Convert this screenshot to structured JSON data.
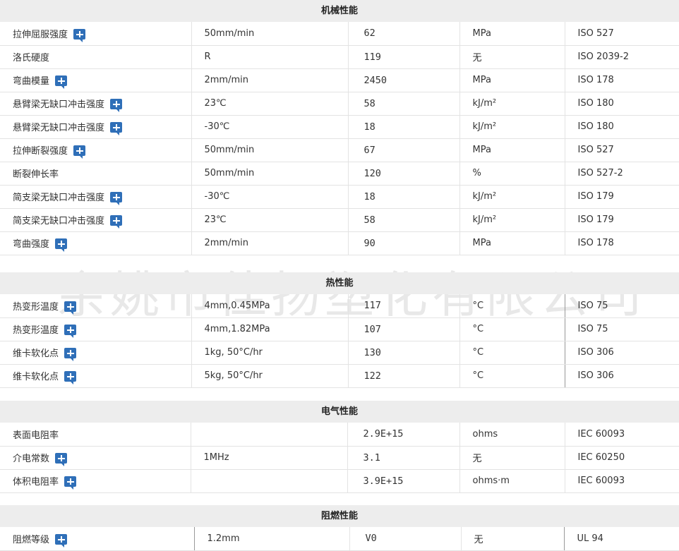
{
  "sections": [
    {
      "title": "机械性能",
      "rows": [
        {
          "property": "拉伸屈服强度",
          "plus": true,
          "condition": "50mm/min",
          "value": "62",
          "unit": "MPa",
          "standard": "ISO 527"
        },
        {
          "property": "洛氏硬度",
          "plus": false,
          "condition": "R",
          "value": "119",
          "unit": "无",
          "standard": "ISO 2039-2"
        },
        {
          "property": "弯曲模量",
          "plus": true,
          "condition": "2mm/min",
          "value": "2450",
          "unit": "MPa",
          "standard": "ISO 178"
        },
        {
          "property": "悬臂梁无缺口冲击强度",
          "plus": true,
          "condition": "23℃",
          "value": "58",
          "unit": "kJ/m²",
          "standard": "ISO 180"
        },
        {
          "property": "悬臂梁无缺口冲击强度",
          "plus": true,
          "condition": "-30℃",
          "value": "18",
          "unit": "kJ/m²",
          "standard": "ISO 180"
        },
        {
          "property": "拉伸断裂强度",
          "plus": true,
          "condition": "50mm/min",
          "value": "67",
          "unit": "MPa",
          "standard": "ISO 527"
        },
        {
          "property": "断裂伸长率",
          "plus": false,
          "condition": "50mm/min",
          "value": "120",
          "unit": "%",
          "standard": "ISO 527-2"
        },
        {
          "property": "简支梁无缺口冲击强度",
          "plus": true,
          "condition": "-30℃",
          "value": "18",
          "unit": "kJ/m²",
          "standard": "ISO 179"
        },
        {
          "property": "简支梁无缺口冲击强度",
          "plus": true,
          "condition": "23℃",
          "value": "58",
          "unit": "kJ/m²",
          "standard": "ISO 179"
        },
        {
          "property": "弯曲强度",
          "plus": true,
          "condition": "2mm/min",
          "value": "90",
          "unit": "MPa",
          "standard": "ISO 178"
        }
      ]
    },
    {
      "title": "热性能",
      "rows": [
        {
          "property": "热变形温度",
          "plus": true,
          "condition": "4mm,0.45MPa",
          "value": "117",
          "unit": "°C",
          "standard": "ISO 75"
        },
        {
          "property": "热变形温度",
          "plus": true,
          "condition": "4mm,1.82MPa",
          "value": "107",
          "unit": "°C",
          "standard": "ISO 75"
        },
        {
          "property": "维卡软化点",
          "plus": true,
          "condition": "1kg, 50°C/hr",
          "value": "130",
          "unit": "°C",
          "standard": "ISO 306"
        },
        {
          "property": "维卡软化点",
          "plus": true,
          "condition": "5kg, 50°C/hr",
          "value": "122",
          "unit": "°C",
          "standard": "ISO 306"
        }
      ]
    },
    {
      "title": "电气性能",
      "rows": [
        {
          "property": "表面电阻率",
          "plus": false,
          "condition": "",
          "value": "2.9E+15",
          "unit": "ohms",
          "standard": "IEC 60093"
        },
        {
          "property": "介电常数",
          "plus": true,
          "condition": "1MHz",
          "value": "3.1",
          "unit": "无",
          "standard": "IEC 60250"
        },
        {
          "property": "体积电阻率",
          "plus": true,
          "condition": "",
          "value": "3.9E+15",
          "unit": "ohms·m",
          "standard": "IEC 60093"
        }
      ]
    },
    {
      "title": "阻燃性能",
      "rows": [
        {
          "property": "阻燃等级",
          "plus": true,
          "condition": "1.2mm",
          "value": "V0",
          "unit": "无",
          "standard": "UL 94"
        }
      ]
    }
  ],
  "watermark": "余姚市佳扬塑化有限公司",
  "colors": {
    "header_bg": "#ededed",
    "plus_icon": "#2f6fb8"
  }
}
